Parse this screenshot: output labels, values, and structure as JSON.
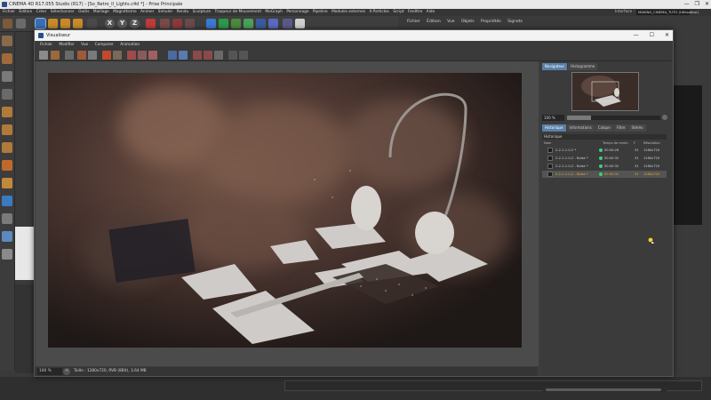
{
  "main_window": {
    "title": "CINEMA 4D R17.055 Studio (R17) - [So_Retro_II_Lights.c4d *] - Prise Principale",
    "menu": [
      "Fichier",
      "Édition",
      "Créer",
      "Sélectionner",
      "Outils",
      "Maillage",
      "Magnétisme",
      "Animer",
      "Simuler",
      "Rendu",
      "Sculpture",
      "Traqueur de Mouvement",
      "MoGraph",
      "Personnage",
      "Pipeline",
      "Modules externes",
      "X-Particles",
      "Script",
      "Fenêtre",
      "Aide"
    ],
    "interface_label": "Interface :",
    "interface_value": "MAKING_CINEMA_TUTO (Utilisateur)",
    "objects_menu": [
      "Fichier",
      "Édition",
      "Vue",
      "Objets",
      "Propriétés",
      "Signets"
    ],
    "toolbar_letters": [
      "X",
      "Y",
      "Z"
    ]
  },
  "viewer": {
    "title": "Visualiseur",
    "menu": [
      "Fichier",
      "Modifier",
      "Vue",
      "Comparer",
      "Animation"
    ],
    "status_zoom": "100 %",
    "status_info": "Taille : 1280x720, RVB (8Bit), 3.64 MB"
  },
  "side_panel": {
    "top_tabs": [
      "Navigateur",
      "Histogramme"
    ],
    "nav_zoom": "100 %",
    "nav_zoom_fraction": 0.26,
    "bottom_tabs": [
      "Historique",
      "Informations",
      "Calque",
      "Filtre",
      "Stéréo"
    ],
    "history_header": "Historique",
    "columns": [
      "Nom",
      "Temps de rendu",
      "F",
      "Résolution"
    ],
    "rows": [
      {
        "name": "2-2-1-1-0-2 *",
        "time": "00:00:26",
        "frame": "31",
        "resolution": "1280x720",
        "selected": false
      },
      {
        "name": "2-2-1-1-0-2 - Noise *",
        "time": "00:00:32",
        "frame": "31",
        "resolution": "1280x720",
        "selected": false
      },
      {
        "name": "2-2-1-1-0-2 - Noise *",
        "time": "00:00:32",
        "frame": "31",
        "resolution": "1280x720",
        "selected": false
      },
      {
        "name": "2-2-1-1-0-2 - Noise *",
        "time": "00:00:31",
        "frame": "31",
        "resolution": "1280x720",
        "selected": true
      }
    ]
  },
  "colors": {
    "selected_text": "#e6a830",
    "render_ok_dot": "#3fcf7a",
    "active_tab": "#5a7fa8"
  }
}
